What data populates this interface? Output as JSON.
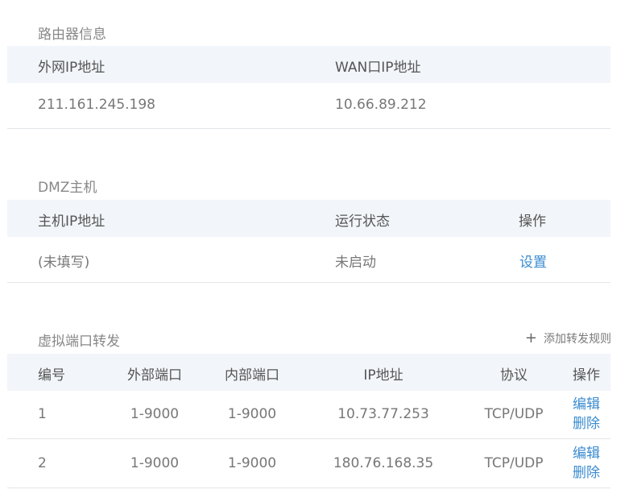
{
  "router_info": {
    "title": "路由器信息",
    "headers": {
      "wan_ip": "外网IP地址",
      "wan_port_ip": "WAN口IP地址"
    },
    "values": {
      "wan_ip": "211.161.245.198",
      "wan_port_ip": "10.66.89.212"
    }
  },
  "dmz": {
    "title": "DMZ主机",
    "headers": {
      "host_ip": "主机IP地址",
      "status": "运行状态",
      "action": "操作"
    },
    "values": {
      "host_ip": "(未填写)",
      "status": "未启动",
      "action": "设置"
    }
  },
  "port_forward": {
    "title": "虚拟端口转发",
    "add_label": "添加转发规则",
    "add_icon": "plus-icon",
    "headers": {
      "id": "编号",
      "ext_port": "外部端口",
      "int_port": "内部端口",
      "ip": "IP地址",
      "protocol": "协议",
      "action": "操作"
    },
    "rows": [
      {
        "id": "1",
        "ext_port": "1-9000",
        "int_port": "1-9000",
        "ip": "10.73.77.253",
        "protocol": "TCP/UDP",
        "edit": "编辑",
        "delete": "删除"
      },
      {
        "id": "2",
        "ext_port": "1-9000",
        "int_port": "1-9000",
        "ip": "180.76.168.35",
        "protocol": "TCP/UDP",
        "edit": "编辑",
        "delete": "删除"
      }
    ]
  },
  "colors": {
    "link": "#3a8bd0",
    "header_bg": "#f2f5f9",
    "divider": "#e3e6ea"
  }
}
